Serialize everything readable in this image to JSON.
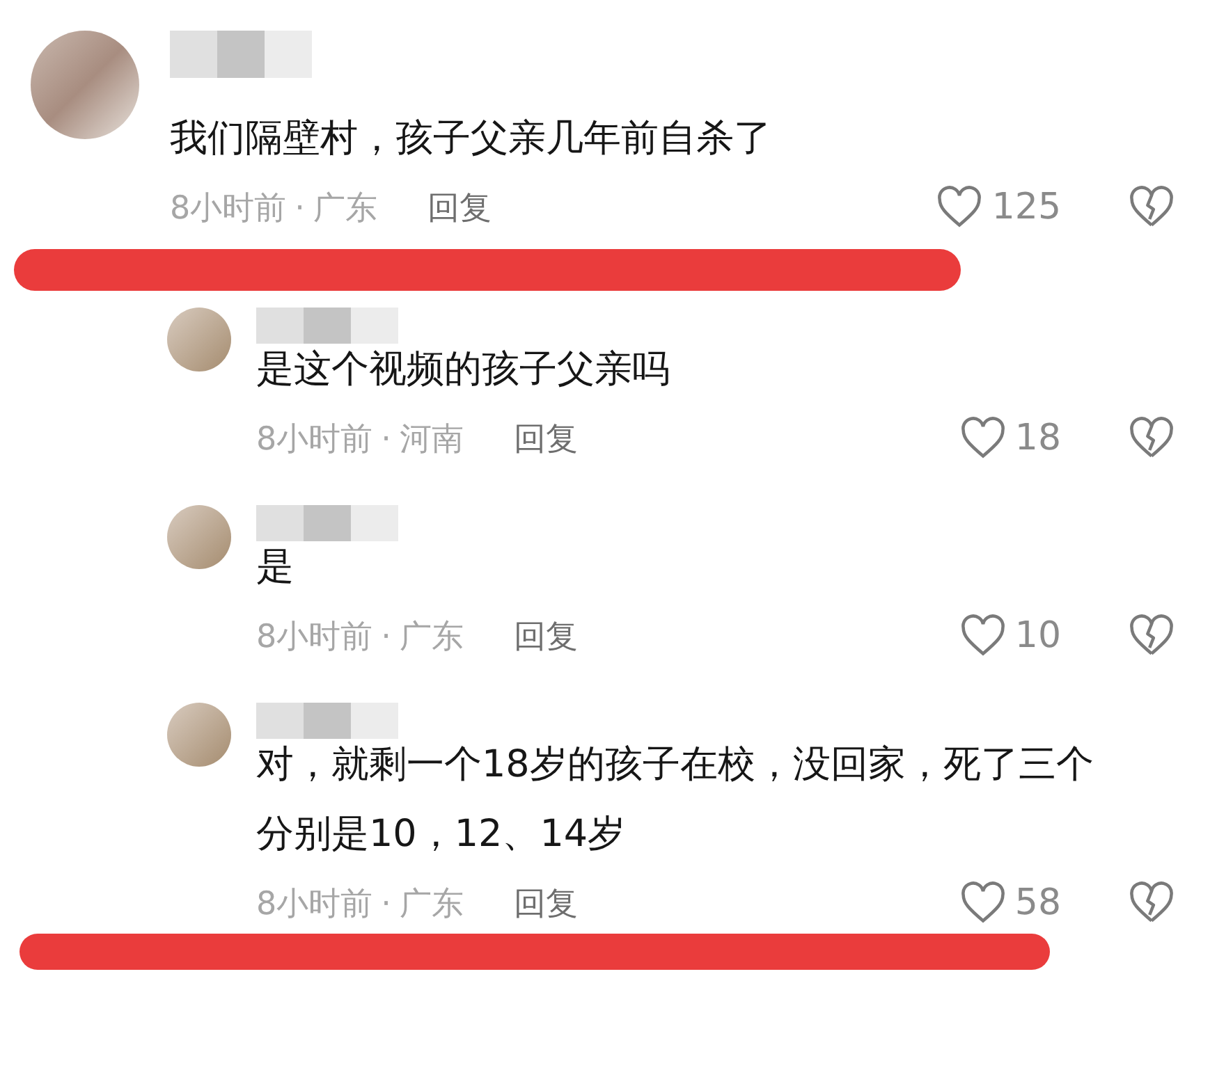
{
  "comments": [
    {
      "text": "我们隔壁村，孩子父亲几年前自杀了",
      "time": "8小时前",
      "separator": "·",
      "location": "广东",
      "reply_label": "回复",
      "likes": "125",
      "underlined": true,
      "children": [
        {
          "text": "是这个视频的孩子父亲吗",
          "time": "8小时前",
          "separator": "·",
          "location": "河南",
          "reply_label": "回复",
          "likes": "18",
          "underlined": false
        },
        {
          "text": "是",
          "time": "8小时前",
          "separator": "·",
          "location": "广东",
          "reply_label": "回复",
          "likes": "10",
          "underlined": false
        },
        {
          "text": "对，就剩一个18岁的孩子在校，没回家，死了三个分别是10，12、14岁",
          "time": "8小时前",
          "separator": "·",
          "location": "广东",
          "reply_label": "回复",
          "likes": "58",
          "underlined": true
        }
      ]
    }
  ]
}
